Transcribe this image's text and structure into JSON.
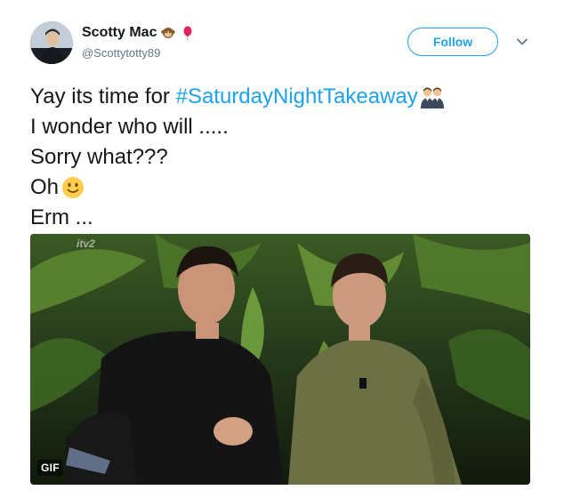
{
  "user": {
    "display_name": "Scotty Mac",
    "handle": "@Scottytotty89",
    "name_emojis": [
      "monkey-icon",
      "balloon-icon"
    ]
  },
  "actions": {
    "follow_label": "Follow",
    "menu_icon": "chevron-down-icon"
  },
  "tweet": {
    "line1_prefix": "Yay its time for ",
    "hashtag": "#SaturdayNightTakeaway",
    "line1_emoji": "two-men-icon",
    "line2": "I wonder who will .....",
    "line3": "Sorry what???",
    "line4": "Oh",
    "line4_emoji": "slightly-smiling-face-icon",
    "line5": "Erm ..."
  },
  "media": {
    "type": "gif",
    "badge": "GIF",
    "watermark": "itv2"
  },
  "colors": {
    "accent": "#1da1f2",
    "text": "#14171a",
    "secondary": "#657786"
  }
}
